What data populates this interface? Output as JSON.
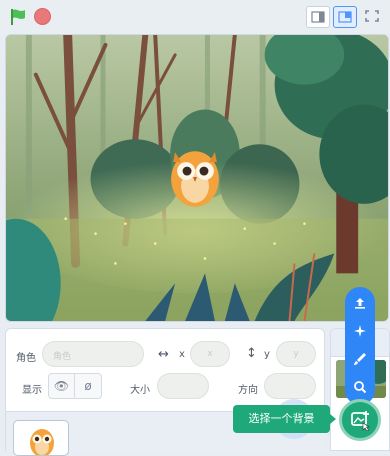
{
  "toolbar": {
    "icons": [
      "green-flag-icon",
      "stop-icon",
      "small-stage-icon",
      "large-stage-icon",
      "fullscreen-icon"
    ]
  },
  "sprite_info": {
    "sprite_label": "角色",
    "sprite_placeholder": "角色",
    "x_label": "x",
    "x_placeholder": "x",
    "y_label": "y",
    "y_placeholder": "y",
    "show_label": "显示",
    "size_label": "大小",
    "direction_label": "方向"
  },
  "backdrop_menu": {
    "tooltip": "选择一个背景",
    "items": [
      "upload-icon",
      "surprise-icon",
      "paint-icon",
      "search-icon"
    ]
  },
  "colors": {
    "accent_blue": "#2f86f7",
    "accent_green": "#1fa97a"
  }
}
